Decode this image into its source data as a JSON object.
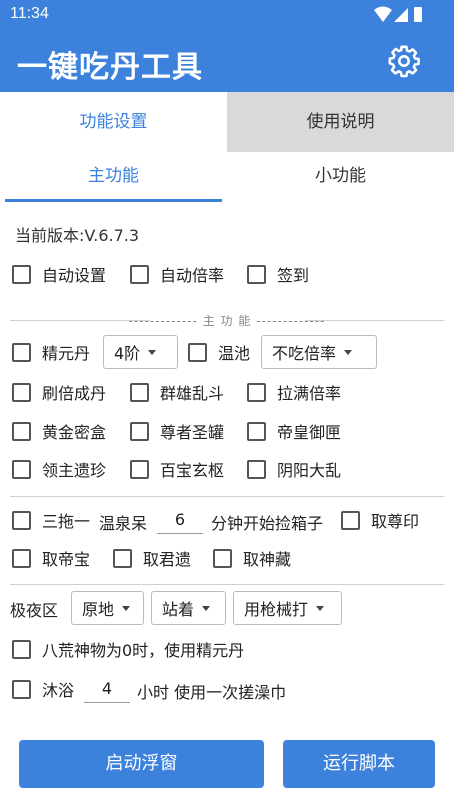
{
  "status": {
    "time": "11:34"
  },
  "app": {
    "title": "一键吃丹工具"
  },
  "tabs_top": [
    {
      "label": "功能设置"
    },
    {
      "label": "使用说明"
    }
  ],
  "tabs_sub": [
    {
      "label": "主功能"
    },
    {
      "label": "小功能"
    }
  ],
  "version": "当前版本:V.6.7.3",
  "top_checks": [
    {
      "label": "自动设置"
    },
    {
      "label": "自动倍率"
    },
    {
      "label": "签到"
    }
  ],
  "section_title": "------------- 主 功 能 -------------",
  "row_jingyuan": {
    "check_label": "精元丹",
    "tier_value": "4阶",
    "pool_label": "温池",
    "pool_value": "不吃倍率"
  },
  "grid_checks": [
    {
      "label": "刷倍成丹"
    },
    {
      "label": "群雄乱斗"
    },
    {
      "label": "拉满倍率"
    },
    {
      "label": "黄金密盒"
    },
    {
      "label": "尊者圣罐"
    },
    {
      "label": "帝皇御匣"
    },
    {
      "label": "领主遗珍"
    },
    {
      "label": "百宝玄枢"
    },
    {
      "label": "阴阳大乱"
    }
  ],
  "tuo": {
    "check_label": "三拖一",
    "text_prefix": "温泉呆",
    "minutes": "6",
    "text_suffix": "分钟开始捡箱子",
    "zunyin_label": "取尊印"
  },
  "take_checks": [
    {
      "label": "取帝宝"
    },
    {
      "label": "取君遗"
    },
    {
      "label": "取神藏"
    }
  ],
  "jiye": {
    "label": "极夜区",
    "position_value": "原地",
    "stance_value": "站着",
    "weapon_value": "用枪械打"
  },
  "bahuang_label": "八荒神物为0时，使用精元丹",
  "bath": {
    "check_label": "沐浴",
    "hours": "4",
    "text_suffix": "小时 使用一次搓澡巾"
  },
  "buttons": {
    "float": "启动浮窗",
    "run": "运行脚本"
  }
}
